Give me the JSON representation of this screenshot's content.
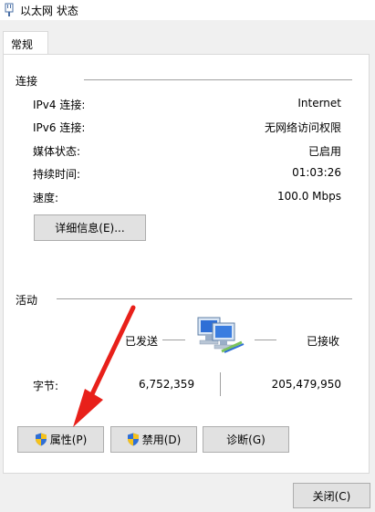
{
  "window": {
    "title": "以太网 状态"
  },
  "tabs": [
    {
      "label": "常规"
    }
  ],
  "connection": {
    "section_label": "连接",
    "rows": [
      {
        "label": "IPv4 连接:",
        "value": "Internet"
      },
      {
        "label": "IPv6 连接:",
        "value": "无网络访问权限"
      },
      {
        "label": "媒体状态:",
        "value": "已启用"
      },
      {
        "label": "持续时间:",
        "value": "01:03:26"
      },
      {
        "label": "速度:",
        "value": "100.0 Mbps"
      }
    ],
    "details_button": "详细信息(E)..."
  },
  "activity": {
    "section_label": "活动",
    "sent_label": "已发送",
    "received_label": "已接收",
    "bytes_label": "字节:",
    "bytes_sent": "6,752,359",
    "bytes_received": "205,479,950"
  },
  "buttons": {
    "properties": "属性(P)",
    "disable": "禁用(D)",
    "diagnose": "诊断(G)",
    "close": "关闭(C)"
  },
  "colors": {
    "annotation_arrow": "#e8201a",
    "accent": "#0078d7"
  },
  "icons": {
    "title": "network-adapter-icon",
    "activity": "network-computers-icon",
    "shield": "uac-shield-icon"
  }
}
